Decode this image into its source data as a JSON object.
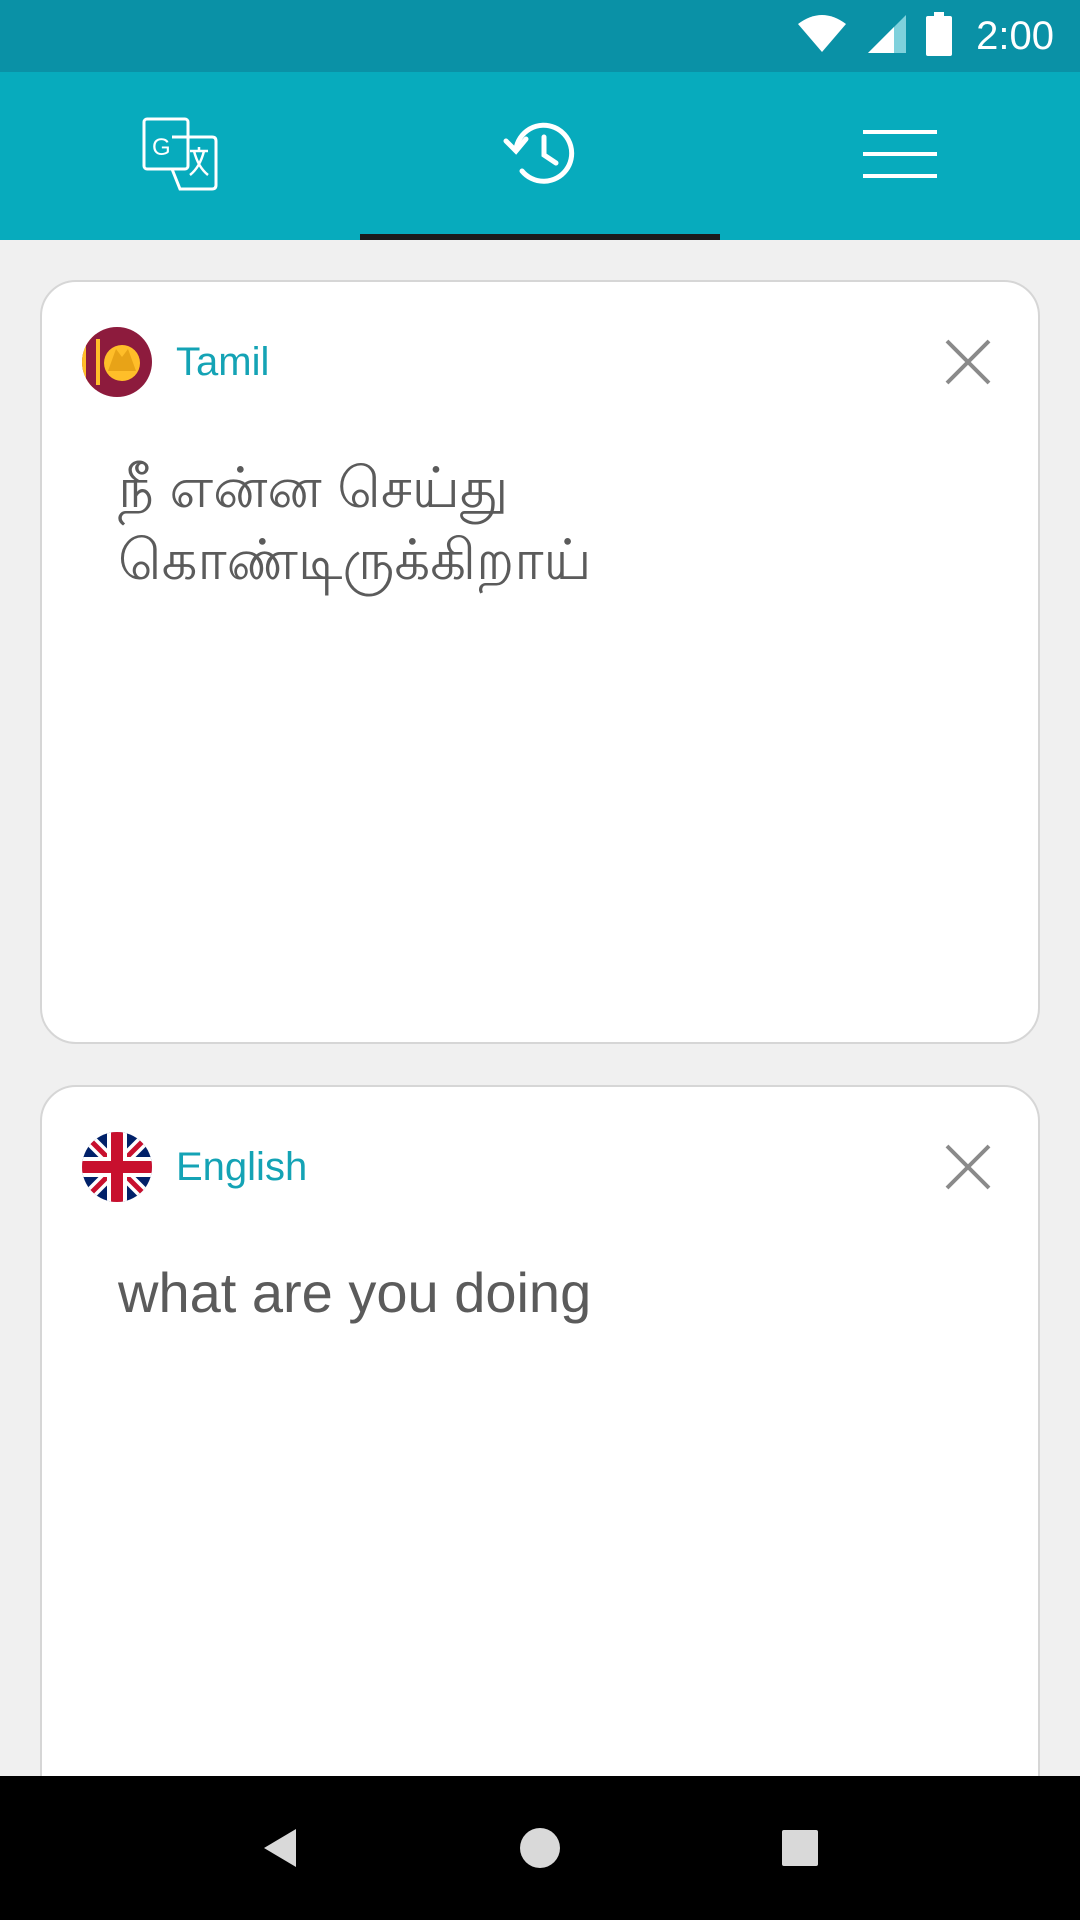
{
  "status_bar": {
    "time": "2:00",
    "icons": [
      "wifi-icon",
      "cell-signal-icon",
      "battery-icon"
    ]
  },
  "tabs": [
    {
      "name": "translate",
      "icon": "translate-icon",
      "active": false
    },
    {
      "name": "history",
      "icon": "history-icon",
      "active": true
    },
    {
      "name": "menu",
      "icon": "menu-icon",
      "active": false
    }
  ],
  "source_card": {
    "language": "Tamil",
    "flag_icon": "sri-lanka-flag-icon",
    "text": "நீ என்ன செய்து\nகொண்டிருக்கிறாய்"
  },
  "target_card": {
    "language": "English",
    "flag_icon": "uk-flag-icon",
    "text": "what are you doing"
  },
  "colors": {
    "status_bar": "#0a91a6",
    "tab_bar": "#07abbd",
    "accent_text": "#14a3b5",
    "body_text": "#5b5b5b",
    "background": "#f0f0f0"
  },
  "nav_bar": {
    "icons": [
      "back-icon",
      "home-icon",
      "recents-icon"
    ]
  }
}
